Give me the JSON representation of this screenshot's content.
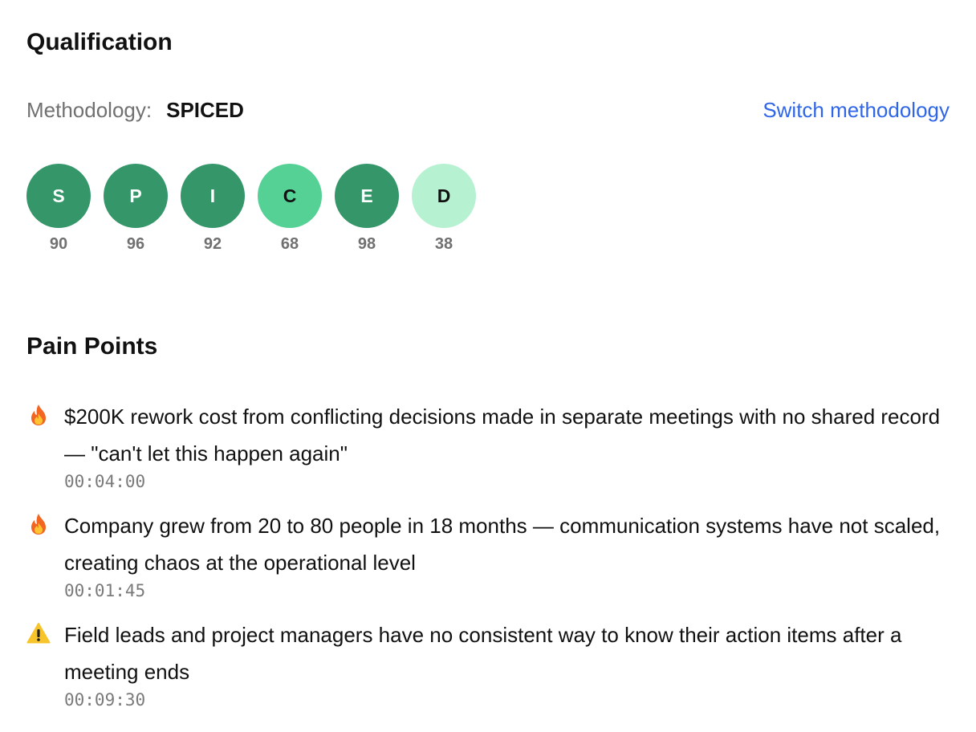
{
  "qualification": {
    "title": "Qualification",
    "methodology_label": "Methodology:",
    "methodology_value": "SPICED",
    "switch_label": "Switch methodology",
    "scores": [
      {
        "letter": "S",
        "value": "90",
        "color": "#35966a",
        "text_color": "#ffffff"
      },
      {
        "letter": "P",
        "value": "96",
        "color": "#35966a",
        "text_color": "#ffffff"
      },
      {
        "letter": "I",
        "value": "92",
        "color": "#35966a",
        "text_color": "#ffffff"
      },
      {
        "letter": "C",
        "value": "68",
        "color": "#55d196",
        "text_color": "#111111"
      },
      {
        "letter": "E",
        "value": "98",
        "color": "#35966a",
        "text_color": "#ffffff"
      },
      {
        "letter": "D",
        "value": "38",
        "color": "#b6f1d1",
        "text_color": "#111111"
      }
    ]
  },
  "pain_points": {
    "title": "Pain Points",
    "items": [
      {
        "icon": "fire-icon",
        "text": "$200K rework cost from conflicting decisions made in separate meetings with no shared record — \"can't let this happen again\"",
        "timestamp": "00:04:00"
      },
      {
        "icon": "fire-icon",
        "text": "Company grew from 20 to 80 people in 18 months — communication systems have not scaled, creating chaos at the operational level",
        "timestamp": "00:01:45"
      },
      {
        "icon": "warning-icon",
        "text": "Field leads and project managers have no consistent way to know their action items after a meeting ends",
        "timestamp": "00:09:30"
      }
    ]
  }
}
